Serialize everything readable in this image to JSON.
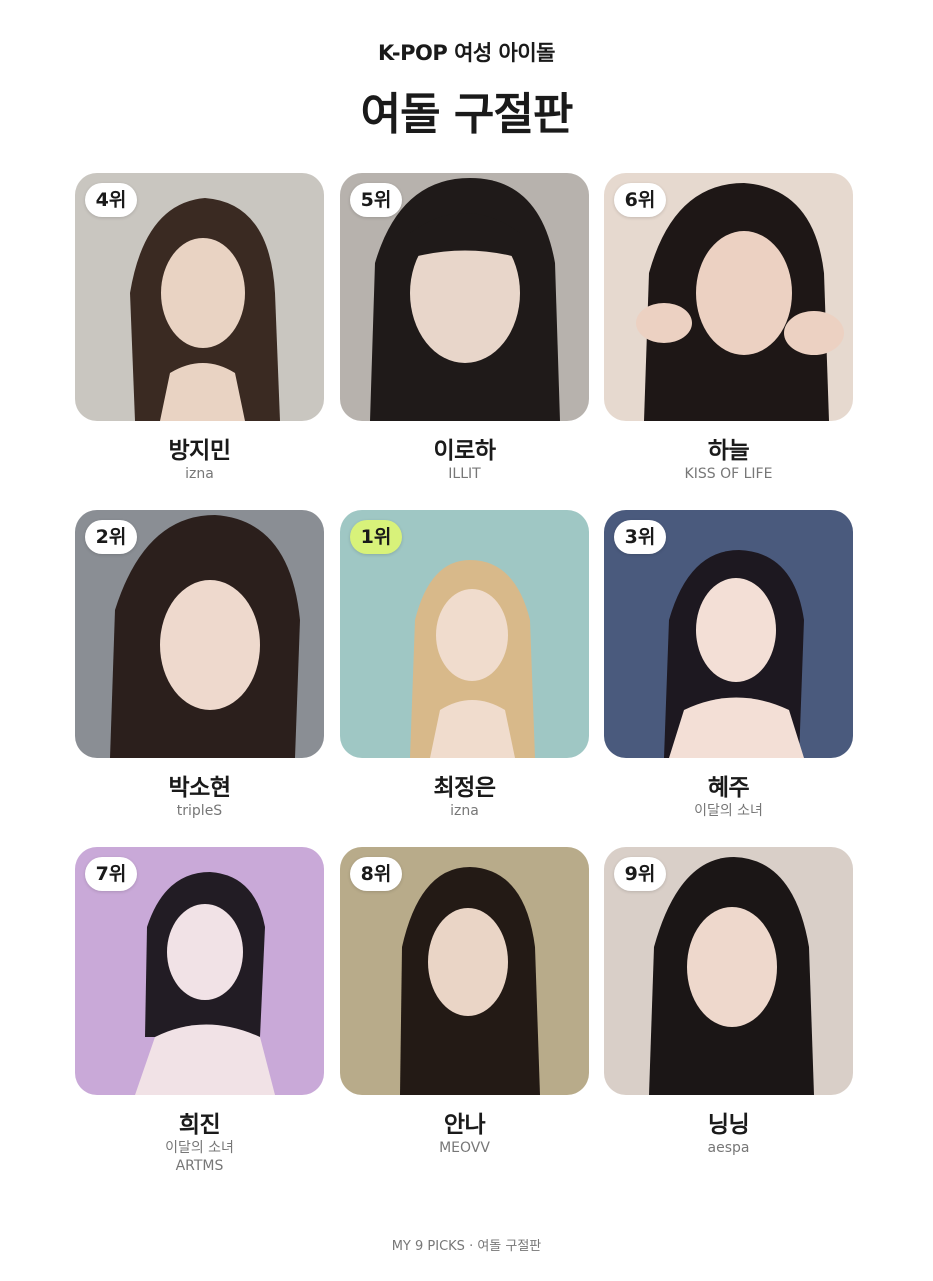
{
  "header": {
    "subtitle": "K-POP 여성 아이돌",
    "title": "여돌 구절판"
  },
  "cards": [
    {
      "rank": "4위",
      "name": "방지민",
      "group": "izna",
      "group2": "",
      "highlight": false,
      "colors": [
        "#c9c6c0",
        "#3a2a22",
        "#e9d3c3"
      ]
    },
    {
      "rank": "5위",
      "name": "이로하",
      "group": "ILLIT",
      "group2": "",
      "highlight": false,
      "colors": [
        "#b7b2ad",
        "#1f1a19",
        "#e8d6ca"
      ]
    },
    {
      "rank": "6위",
      "name": "하늘",
      "group": "KISS OF LIFE",
      "group2": "",
      "highlight": false,
      "colors": [
        "#e6d9cf",
        "#1e1716",
        "#ecd1c2"
      ]
    },
    {
      "rank": "2위",
      "name": "박소현",
      "group": "tripleS",
      "group2": "",
      "highlight": false,
      "colors": [
        "#8a8e94",
        "#2b1f1c",
        "#eed9cd"
      ]
    },
    {
      "rank": "1위",
      "name": "최정은",
      "group": "izna",
      "group2": "",
      "highlight": true,
      "colors": [
        "#9fc7c4",
        "#d8b98a",
        "#f0dccd"
      ]
    },
    {
      "rank": "3위",
      "name": "혜주",
      "group": "이달의 소녀",
      "group2": "",
      "highlight": false,
      "colors": [
        "#4a5a7d",
        "#1d1820",
        "#f3dfd6"
      ]
    },
    {
      "rank": "7위",
      "name": "희진",
      "group": "이달의 소녀",
      "group2": "ARTMS",
      "highlight": false,
      "colors": [
        "#c9a9d8",
        "#221c24",
        "#f1e2e6"
      ]
    },
    {
      "rank": "8위",
      "name": "안나",
      "group": "MEOVV",
      "group2": "",
      "highlight": false,
      "colors": [
        "#b8ab8a",
        "#231a15",
        "#ead5c6"
      ]
    },
    {
      "rank": "9위",
      "name": "닝닝",
      "group": "aespa",
      "group2": "",
      "highlight": false,
      "colors": [
        "#d9cfc8",
        "#1b1616",
        "#eed8cc"
      ]
    }
  ],
  "footer": {
    "text": "MY 9 PICKS · 여돌 구절판"
  }
}
